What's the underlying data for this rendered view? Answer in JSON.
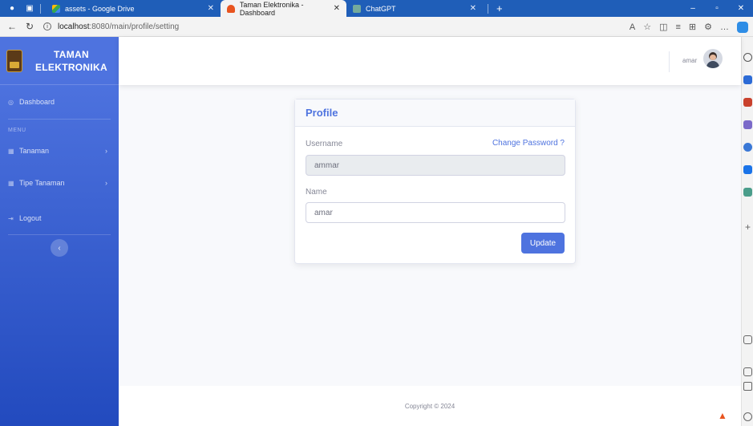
{
  "browser": {
    "tabs": [
      {
        "title": "assets - Google Drive",
        "active": false
      },
      {
        "title": "Taman Elektronika - Dashboard",
        "active": true
      },
      {
        "title": "ChatGPT",
        "active": false
      }
    ],
    "new_tab": "+",
    "url_host": "localhost",
    "url_path": ":8080/main/profile/setting",
    "window_controls": [
      "–",
      "▫",
      "✕"
    ]
  },
  "sidebar": {
    "brand_line1": "TAMAN",
    "brand_line2": "ELEKTRONIKA",
    "dashboard": "Dashboard",
    "menu_heading": "MENU",
    "items": [
      {
        "label": "Tanaman",
        "icon": "table-icon",
        "has_submenu": true
      },
      {
        "label": "Tipe Tanaman",
        "icon": "table-icon",
        "has_submenu": true
      }
    ],
    "logout": "Logout",
    "toggle_icon": "‹"
  },
  "topbar": {
    "user_name": "amar"
  },
  "profile": {
    "title": "Profile",
    "username_label": "Username",
    "change_password": "Change Password ?",
    "username_value": "ammar",
    "name_label": "Name",
    "name_value": "amar",
    "update_button": "Update"
  },
  "footer": {
    "copyright": "Copyright © 2024"
  },
  "colors": {
    "primary": "#4e73df",
    "sidebar_bottom": "#224abe",
    "browser_tabbar": "#1f5eb8"
  }
}
